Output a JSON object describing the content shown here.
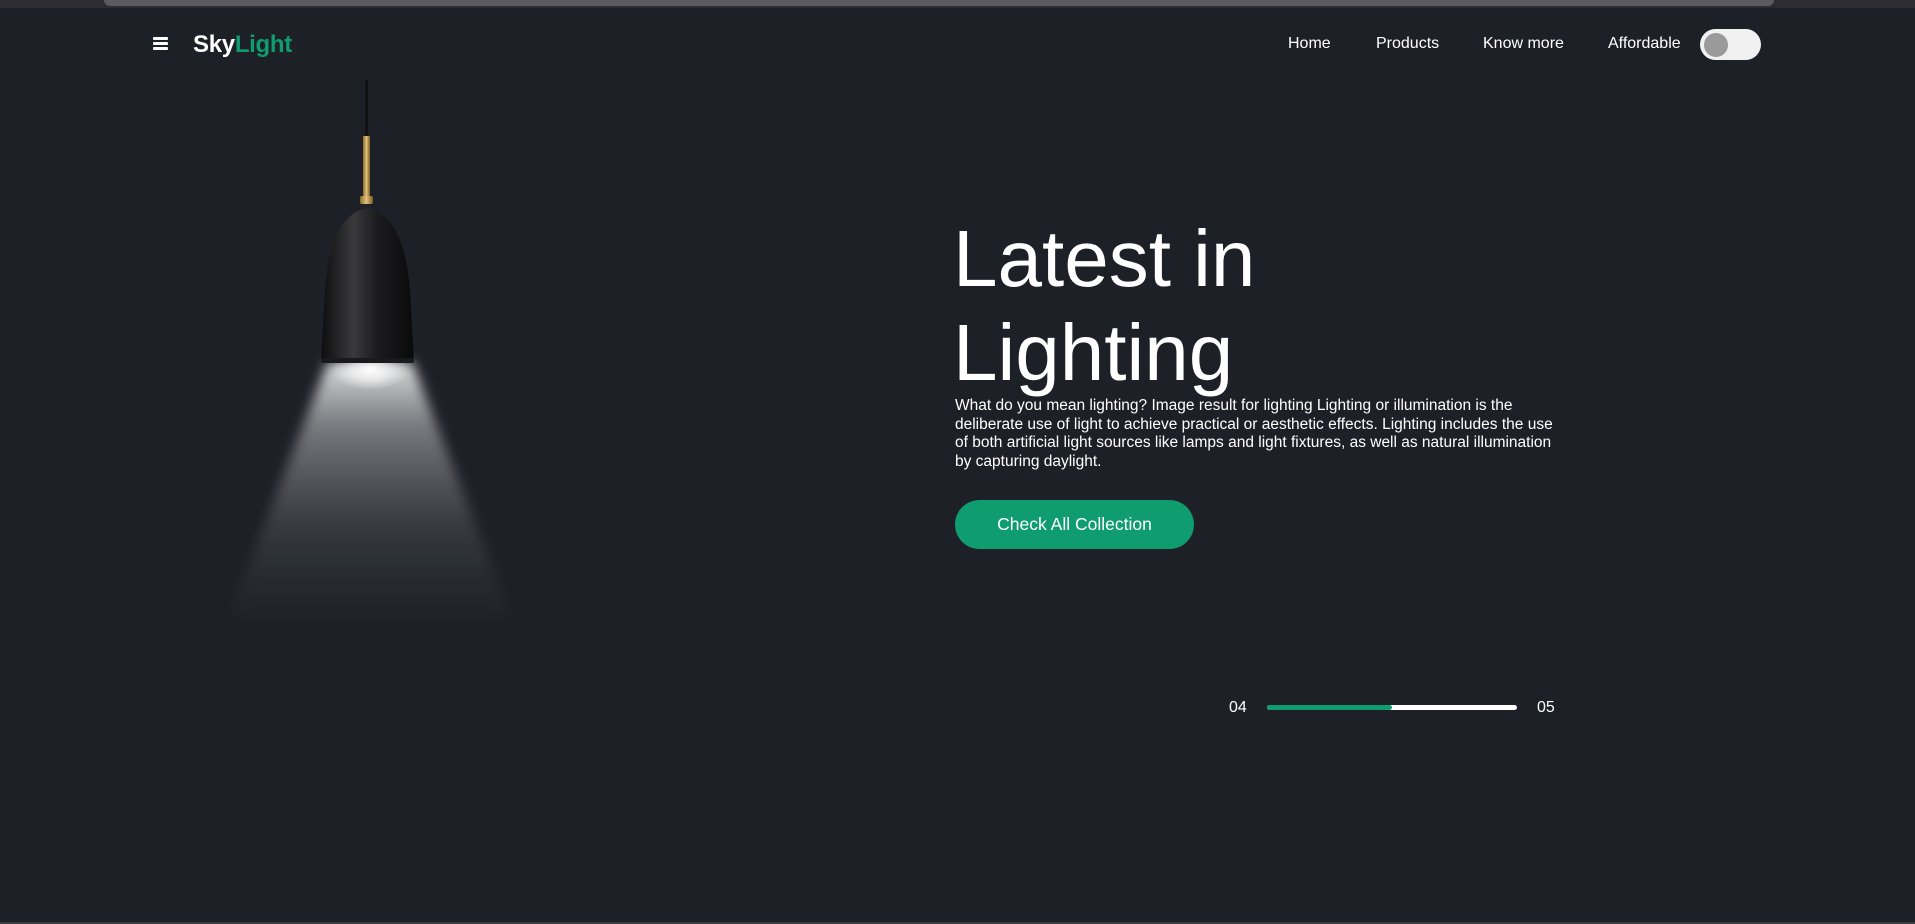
{
  "header": {
    "logo_part1": "Sky",
    "logo_part2": "Light",
    "nav": [
      "Home",
      "Products",
      "Know more",
      "Affordable"
    ],
    "toggle_on": false
  },
  "hero": {
    "title_line1": "Latest in",
    "title_line2": "Lighting",
    "description": "What do you mean lighting? Image result for lighting Lighting or illumination is the deliberate use of light to achieve practical or aesthetic effects. Lighting includes the use of both artificial light sources like lamps and light fixtures, as well as natural illumination by capturing daylight.",
    "cta_label": "Check All Collection"
  },
  "slider": {
    "current": "04",
    "total": "05",
    "progress_fraction": 0.5
  },
  "colors": {
    "background": "#1e2028",
    "accent": "#0f9c6f",
    "text": "#ffffff"
  }
}
